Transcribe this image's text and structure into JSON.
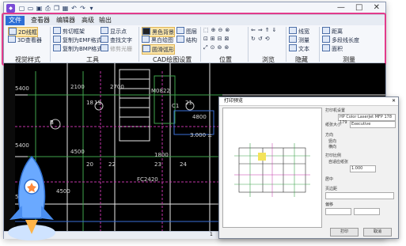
{
  "app": {
    "window_controls": "— □ ✕"
  },
  "tabs": [
    {
      "label": "文件",
      "active": true
    },
    {
      "label": "查看器"
    },
    {
      "label": "编辑器"
    },
    {
      "label": "高级"
    },
    {
      "label": "输出"
    }
  ],
  "ribbon": {
    "view_style": {
      "btn_2d": "2D线框",
      "btn_3d": "3D查看器",
      "group": "视觉样式"
    },
    "tools": {
      "clip": "剪切框架",
      "copy_emf": "复制为EMF格式",
      "copy_bmp": "复制为BMP格式",
      "show_points": "显示点",
      "find_text": "查找文字",
      "trim_raster": "修剪光栅",
      "group": "工具"
    },
    "cad_settings": {
      "black_bg": "黑色背景",
      "bw_draw": "黑白绘图",
      "smooth_arc": "圆滑弧形",
      "layers": "图层",
      "structure": "结构",
      "group": "CAD绘图设置"
    },
    "position": {
      "group": "位置"
    },
    "browse": {
      "group": "浏览"
    },
    "hide": {
      "line_width": "线宽",
      "measure": "测量",
      "text": "文本",
      "group": "隐藏"
    },
    "measure": {
      "distance": "距离",
      "polyline_len": "多段线长度",
      "area": "面积",
      "group": "测量"
    }
  },
  "drawing": {
    "dims": [
      "5400",
      "5400",
      "5400",
      "2100",
      "4500",
      "2700",
      "1800",
      "4800",
      "4500"
    ],
    "labels": [
      "M0822",
      "C1",
      "FC2420",
      "3.000 ±",
      "B"
    ],
    "axis_marks": [
      "18",
      "19",
      "21",
      "20",
      "22",
      "23",
      "24"
    ]
  },
  "status": {
    "text": "1"
  },
  "print_dialog": {
    "title": "打印预览",
    "printer_label": "打印机设置",
    "printer": "HP Color LaserJet MFP 178 179",
    "paper_label": "纸张大小",
    "paper": "Executive",
    "orientation_label": "方向",
    "portrait": "竖向",
    "landscape": "横向",
    "scale_label": "打印比例",
    "fit": "自适应纸张",
    "scale_value": "1.000",
    "center_label": "居中",
    "margin_label": "页边距",
    "offset_label": "偏移",
    "print_btn": "打印",
    "cancel_btn": "取消"
  }
}
